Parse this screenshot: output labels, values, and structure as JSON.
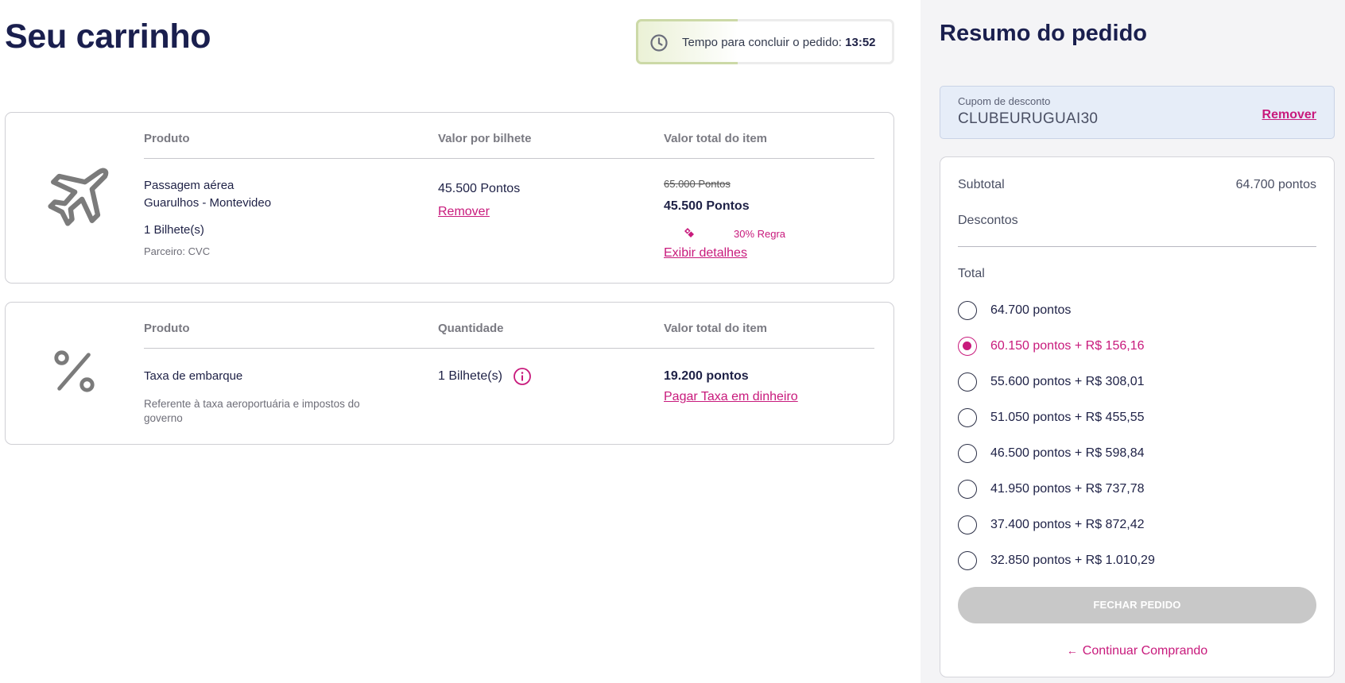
{
  "header": {
    "title": "Seu carrinho",
    "timer_label": "Tempo para concluir o pedido:",
    "timer_value": "13:52"
  },
  "items": [
    {
      "icon": "airplane-icon",
      "col_product": "Produto",
      "col_mid": "Valor por bilhete",
      "col_total": "Valor total do item",
      "name_line1": "Passagem aérea",
      "name_line2": "Guarulhos - Montevideo",
      "qty": "1 Bilhete(s)",
      "partner": "Parceiro: CVC",
      "unit_value": "45.500 Pontos",
      "remove": "Remover",
      "original_total": "65.000 Pontos",
      "total": "45.500 Pontos",
      "promo": "30% Regra",
      "details": "Exibir detalhes"
    },
    {
      "icon": "percent-icon",
      "col_product": "Produto",
      "col_mid": "Quantidade",
      "col_total": "Valor total do item",
      "name": "Taxa de embarque",
      "desc_line1": "Referente à taxa aeroportuária e impostos do",
      "desc_line2": "governo",
      "qty": "1 Bilhete(s)",
      "total": "19.200 pontos",
      "pay_cash": "Pagar Taxa em dinheiro"
    }
  ],
  "summary": {
    "title": "Resumo do pedido",
    "coupon_label": "Cupom de desconto",
    "coupon_code": "CLUBEURUGUAI30",
    "coupon_remove": "Remover",
    "subtotal_label": "Subtotal",
    "subtotal_value": "64.700 pontos",
    "discounts_label": "Descontos",
    "total_label": "Total",
    "options": [
      "64.700 pontos",
      "60.150 pontos + R$ 156,16",
      "55.600 pontos + R$ 308,01",
      "51.050 pontos + R$ 455,55",
      "46.500 pontos + R$ 598,84",
      "41.950 pontos + R$ 737,78",
      "37.400 pontos + R$ 872,42",
      "32.850 pontos + R$ 1.010,29"
    ],
    "selected_index": 1,
    "close_button": "FECHAR PEDIDO",
    "continue": "Continuar Comprando"
  },
  "colors": {
    "accent": "#c81a7c",
    "title": "#1a1f4e",
    "disabled_button": "#c8c8c8"
  }
}
